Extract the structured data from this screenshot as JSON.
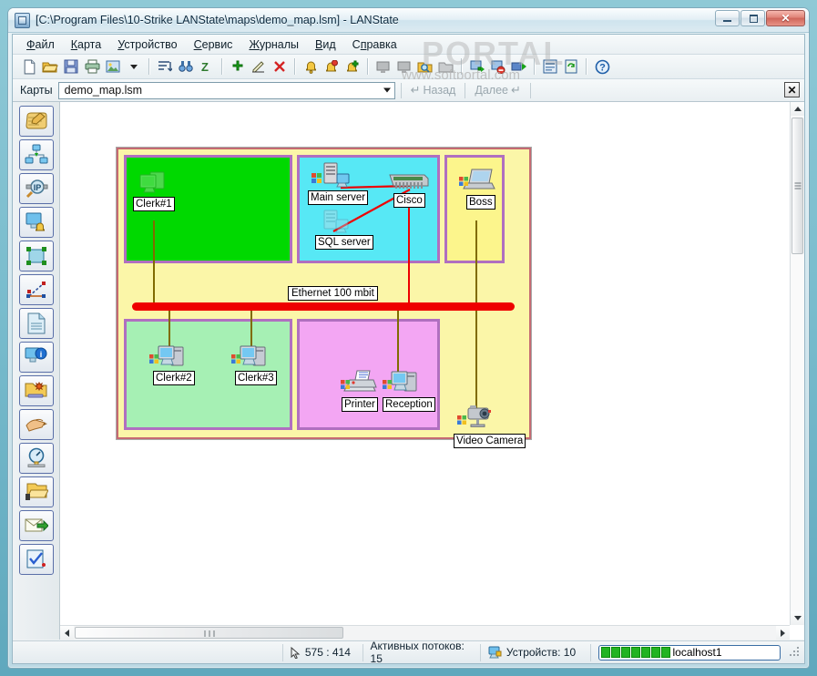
{
  "window": {
    "title": "[C:\\Program Files\\10-Strike LANState\\maps\\demo_map.lsm] - LANState",
    "icon": "app-icon",
    "minimize_label": "",
    "maximize_label": "",
    "close_label": "✕"
  },
  "watermark": {
    "top": "PORTAL",
    "bottom": "www.softportal.com"
  },
  "menu": {
    "items": [
      {
        "label": "Файл",
        "accel": "Ф"
      },
      {
        "label": "Карта",
        "accel": "К"
      },
      {
        "label": "Устройство",
        "accel": "У"
      },
      {
        "label": "Сервис",
        "accel": "С"
      },
      {
        "label": "Журналы",
        "accel": "Ж"
      },
      {
        "label": "Вид",
        "accel": "В"
      },
      {
        "label": "Справка",
        "accel": "п"
      }
    ]
  },
  "toolbar": {
    "buttons": [
      {
        "name": "new-document-icon"
      },
      {
        "name": "open-folder-icon"
      },
      {
        "name": "save-disk-icon"
      },
      {
        "name": "print-icon"
      },
      {
        "name": "export-image-icon"
      },
      {
        "name": "dropdown-arrow-icon"
      },
      {
        "name": "list-view-icon"
      },
      {
        "name": "find-binoculars-icon"
      },
      {
        "name": "refresh-z-icon"
      },
      {
        "name": "add-device-plus-icon"
      },
      {
        "name": "edit-pencil-icon"
      },
      {
        "name": "delete-cross-icon"
      },
      {
        "name": "alert-bell-icon"
      },
      {
        "name": "alert-bell-off-icon"
      },
      {
        "name": "alert-bell-add-icon"
      },
      {
        "name": "folder-grey-icon"
      },
      {
        "name": "folder-grey-2-icon"
      },
      {
        "name": "folder-search-icon"
      },
      {
        "name": "monitor-grey-icon"
      },
      {
        "name": "start-monitoring-icon"
      },
      {
        "name": "stop-monitoring-icon"
      },
      {
        "name": "run-icon"
      },
      {
        "name": "report-icon"
      },
      {
        "name": "refresh-icon"
      },
      {
        "name": "help-icon"
      }
    ]
  },
  "maps_bar": {
    "label": "Карты",
    "selected_map": "demo_map.lsm",
    "placeholder": "demo_map.lsm",
    "back_label": "Назад",
    "forward_label": "Далее",
    "close_label": "✕"
  },
  "sidebar": {
    "items": [
      {
        "name": "sidebar-item-map-wizard",
        "icon": "scroll-pencil-icon"
      },
      {
        "name": "sidebar-item-network-scan",
        "icon": "network-nodes-icon"
      },
      {
        "name": "sidebar-item-ip-scan",
        "icon": "ip-magnifier-icon"
      },
      {
        "name": "sidebar-item-alerts",
        "icon": "monitor-bell-icon"
      },
      {
        "name": "sidebar-item-select-area",
        "icon": "select-rectangle-icon"
      },
      {
        "name": "sidebar-item-draw-link",
        "icon": "link-line-icon"
      },
      {
        "name": "sidebar-item-document",
        "icon": "page-lines-icon"
      },
      {
        "name": "sidebar-item-device-info",
        "icon": "monitor-info-icon"
      },
      {
        "name": "sidebar-item-folder-settings",
        "icon": "folder-gear-icon"
      },
      {
        "name": "sidebar-item-pointer-hand",
        "icon": "hand-pointer-icon"
      },
      {
        "name": "sidebar-item-speed-gauge",
        "icon": "gauge-icon"
      },
      {
        "name": "sidebar-item-open-folder",
        "icon": "folder-open-hand-icon"
      },
      {
        "name": "sidebar-item-send-mail",
        "icon": "mail-send-icon"
      },
      {
        "name": "sidebar-item-checklist",
        "icon": "clipboard-check-icon"
      }
    ]
  },
  "map": {
    "title": "demo_map.lsm",
    "zones": [
      {
        "name": "zone-clerk1",
        "fill": "#00d900",
        "border": "#b06fc0",
        "label": ""
      },
      {
        "name": "zone-servers",
        "fill": "#57e8f5",
        "border": "#b06fc0",
        "label": ""
      },
      {
        "name": "zone-boss",
        "fill": "#fcf58c",
        "border": "#b06fc0",
        "label": ""
      },
      {
        "name": "zone-ethernet",
        "fill": "#fbf6a8",
        "border": "#b06fc0",
        "label": "Ethernet 100 mbit"
      },
      {
        "name": "zone-clerks",
        "fill": "#a6f0b4",
        "border": "#b06fc0",
        "label": ""
      },
      {
        "name": "zone-reception",
        "fill": "#f3a6f3",
        "border": "#b06fc0",
        "label": ""
      }
    ],
    "bus_label": "Ethernet 100 mbit",
    "nodes": [
      {
        "name": "node-clerk1",
        "label": "Clerk#1",
        "icon": "workstation-offline-icon",
        "status": "offline"
      },
      {
        "name": "node-main-server",
        "label": "Main server",
        "icon": "server-icon",
        "status": "online"
      },
      {
        "name": "node-sql-server",
        "label": "SQL server",
        "icon": "server-offline-icon",
        "status": "offline"
      },
      {
        "name": "node-cisco",
        "label": "Cisco",
        "icon": "switch-icon",
        "status": "online"
      },
      {
        "name": "node-boss",
        "label": "Boss",
        "icon": "laptop-icon",
        "status": "online"
      },
      {
        "name": "node-clerk2",
        "label": "Clerk#2",
        "icon": "workstation-icon",
        "status": "online"
      },
      {
        "name": "node-clerk3",
        "label": "Clerk#3",
        "icon": "workstation-icon",
        "status": "online"
      },
      {
        "name": "node-printer",
        "label": "Printer",
        "icon": "printer-icon",
        "status": "online"
      },
      {
        "name": "node-reception",
        "label": "Reception",
        "icon": "workstation-icon",
        "status": "online"
      },
      {
        "name": "node-video-camera",
        "label": "Video Camera",
        "icon": "video-camera-icon",
        "status": "online"
      }
    ]
  },
  "status_bar": {
    "coordinates": "575 : 414",
    "threads": "Активных потоков: 15",
    "devices": "Устройств: 10",
    "host": "localhost1",
    "progress_blocks": 7
  }
}
